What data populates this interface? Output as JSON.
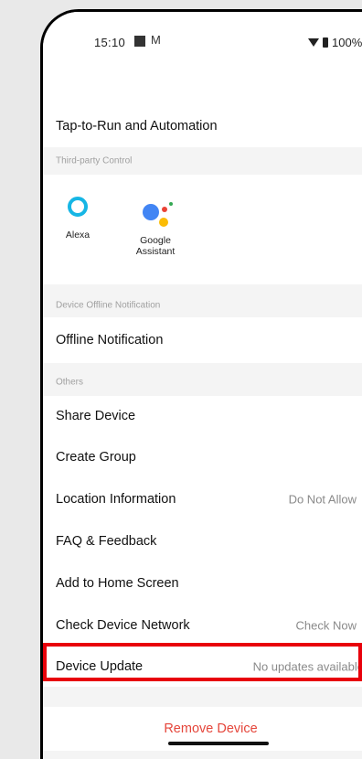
{
  "status_bar": {
    "time": "15:10",
    "mail_icon": "M",
    "battery": "100%"
  },
  "nav": {
    "back_icon": "chevron-left-icon"
  },
  "rows": {
    "tap_to_run": "Tap-to-Run and Automation",
    "offline_notification": "Offline Notification",
    "share_device": "Share Device",
    "create_group": "Create Group",
    "location_information": "Location Information",
    "location_value": "Do Not Allow",
    "faq_feedback": "FAQ & Feedback",
    "add_home_screen": "Add to Home Screen",
    "check_network": "Check Device Network",
    "check_network_value": "Check Now",
    "device_update": "Device Update",
    "device_update_value": "No updates available",
    "remove_device": "Remove Device"
  },
  "sections": {
    "third_party": "Third-party Control",
    "offline": "Device Offline Notification",
    "others": "Others"
  },
  "third_party_items": [
    {
      "label": "Alexa"
    },
    {
      "label": "Google\nAssistant"
    }
  ],
  "toggle": {
    "offline_notification_on": false
  },
  "colors": {
    "accent_red": "#e8000b",
    "remove_text": "#e5463b",
    "alexa_blue": "#16b6e5",
    "google_blue": "#4285f4",
    "google_red": "#ea4335",
    "google_yellow": "#fbbc05",
    "google_green": "#34a853"
  }
}
